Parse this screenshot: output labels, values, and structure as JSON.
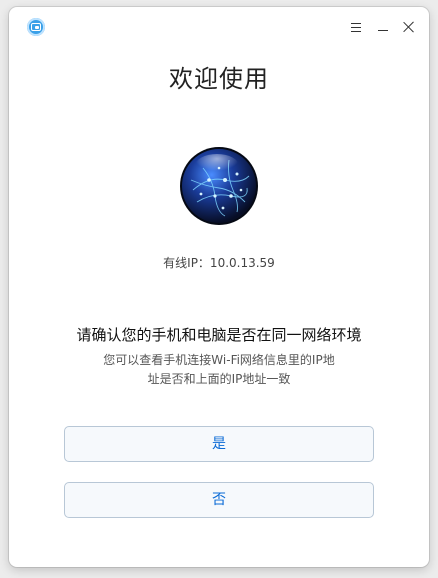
{
  "titlebar": {
    "app_icon": "monitor-connect-icon",
    "menu_icon": "menu-icon",
    "minimize_icon": "minimize-icon",
    "close_icon": "close-icon"
  },
  "main": {
    "title": "欢迎使用",
    "illustration": "network-globe-icon",
    "ip_label": "有线IP：10.0.13.59",
    "question": "请确认您的手机和电脑是否在同一网络环境",
    "hint_line1": "您可以查看手机连接Wi-Fi网络信息里的IP地",
    "hint_line2": "址是否和上面的IP地址一致",
    "yes_label": "是",
    "no_label": "否"
  },
  "colors": {
    "accent": "#0b6bd6",
    "button_border": "#b8c7d6",
    "globe_dark": "#0a1330",
    "globe_light": "#3a7bff"
  }
}
